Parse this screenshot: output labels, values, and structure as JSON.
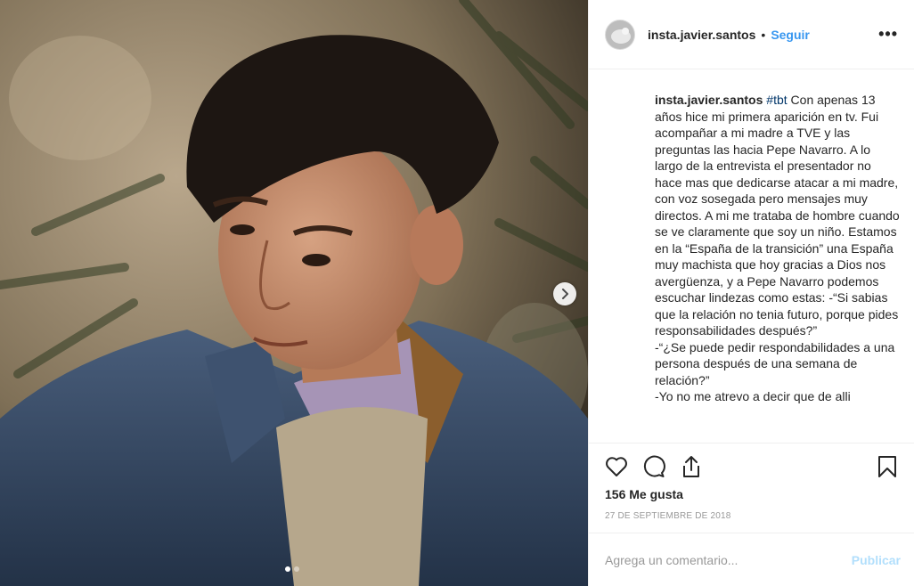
{
  "post": {
    "image_alt": "",
    "carousel": {
      "total": 2,
      "current": 1
    }
  },
  "header": {
    "username": "insta.javier.santos",
    "separator": "•",
    "follow_label": "Seguir",
    "more_label": "•••"
  },
  "caption": {
    "username": "insta.javier.santos",
    "hashtag": "#tbt",
    "text": " Con apenas 13 años hice mi primera aparición en tv. Fui acompañar a mi madre a TVE y las preguntas las hacia Pepe Navarro. A lo largo de la entrevista el presentador no hace mas que dedicarse atacar a mi madre, con voz sosegada pero mensajes muy directos. A mi me trataba de hombre cuando se ve claramente que soy un niño. Estamos en la “España de la transición” una España muy machista que hoy gracias a Dios nos avergüenza, y a Pepe Navarro podemos escuchar lindezas como estas: -“Si sabias que la relación no tenia futuro, porque pides responsabilidades después?”\n-“¿Se puede pedir respondabilidades a una persona después de una semana de relación?”\n-Yo no me atrevo a decir que de alli"
  },
  "engagement": {
    "likes": "156 Me gusta",
    "date": "27 DE SEPTIEMBRE DE 2018"
  },
  "comment": {
    "placeholder": "Agrega un comentario...",
    "publish_label": "Publicar"
  },
  "icons": {
    "like": "heart-icon",
    "comment": "comment-icon",
    "share": "share-icon",
    "save": "bookmark-icon",
    "next": "chevron-right-icon"
  },
  "colors": {
    "link_blue": "#3897f0",
    "hashtag": "#003569",
    "publish_disabled": "#b2dffc",
    "muted": "#999999",
    "border": "#efefef"
  }
}
